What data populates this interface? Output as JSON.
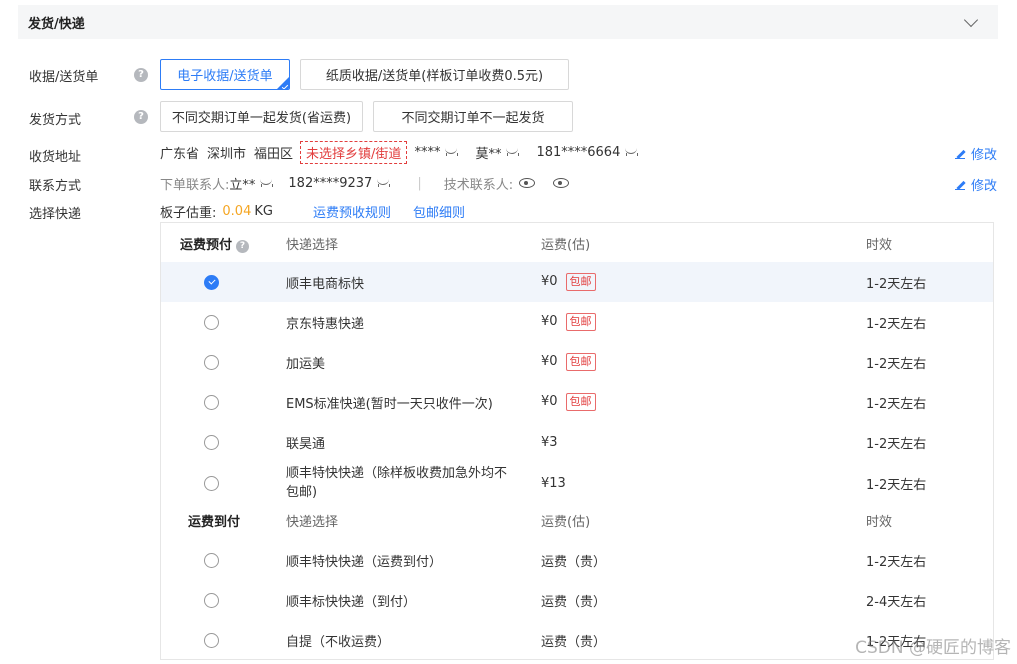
{
  "section": {
    "title": "发货/快递"
  },
  "receipt": {
    "label": "收据/送货单",
    "help": "?",
    "options": [
      "电子收据/送货单",
      "纸质收据/送货单(样板订单收费0.5元)"
    ],
    "selected_index": 0
  },
  "ship_method": {
    "label": "发货方式",
    "help": "?",
    "options": [
      "不同交期订单一起发货(省运费)",
      "不同交期订单不一起发货"
    ]
  },
  "address": {
    "label": "收货地址",
    "province": "广东省",
    "city": "深圳市",
    "district": "福田区",
    "warning": "未选择乡镇/街道",
    "detail": "****",
    "name": "莫**",
    "phone": "181****6664",
    "edit": "修改"
  },
  "contact": {
    "label": "联系方式",
    "order_contact_label": "下单联系人:",
    "order_contact_name": "立**",
    "order_contact_phone": "182****9237",
    "separator": "|",
    "tech_contact_label": "技术联系人:",
    "edit": "修改"
  },
  "express": {
    "label": "选择快递",
    "weight_label": "板子估重:",
    "weight_value": "0.04",
    "weight_unit": "KG",
    "links": [
      "运费预收规则",
      "包邮细则"
    ],
    "prepaid": {
      "group_label": "运费预付",
      "col_express": "快递选择",
      "col_fee": "运费(估)",
      "col_time": "时效",
      "rows": [
        {
          "name": "顺丰电商标快",
          "fee": "¥0",
          "badge": "包邮",
          "time": "1-2天左右",
          "checked": true
        },
        {
          "name": "京东特惠快递",
          "fee": "¥0",
          "badge": "包邮",
          "time": "1-2天左右",
          "checked": false
        },
        {
          "name": "加运美",
          "fee": "¥0",
          "badge": "包邮",
          "time": "1-2天左右",
          "checked": false
        },
        {
          "name": "EMS标准快递(暂时一天只收件一次)",
          "fee": "¥0",
          "badge": "包邮",
          "time": "1-2天左右",
          "checked": false
        },
        {
          "name": "联昊通",
          "fee": "¥3",
          "badge": "",
          "time": "1-2天左右",
          "checked": false
        },
        {
          "name": "顺丰特快快递（除样板收费加急外均不包邮）",
          "name_line1": "顺丰特快快递（除样板收费加急外均不",
          "name_line2": "包邮)",
          "fee": "¥13",
          "badge": "",
          "time": "1-2天左右",
          "checked": false
        }
      ]
    },
    "cod": {
      "group_label": "运费到付",
      "col_express": "快递选择",
      "col_fee": "运费(估)",
      "col_time": "时效",
      "rows": [
        {
          "name": "顺丰特快快递（运费到付）",
          "fee": "运费（贵）",
          "time": "1-2天左右"
        },
        {
          "name": "顺丰标快快递（到付）",
          "fee": "运费（贵）",
          "time": "2-4天左右"
        },
        {
          "name": "自提（不收运费）",
          "fee": "运费（贵）",
          "time": "1-2天左右"
        }
      ]
    }
  },
  "watermark": "CSDN @硬匠的博客"
}
